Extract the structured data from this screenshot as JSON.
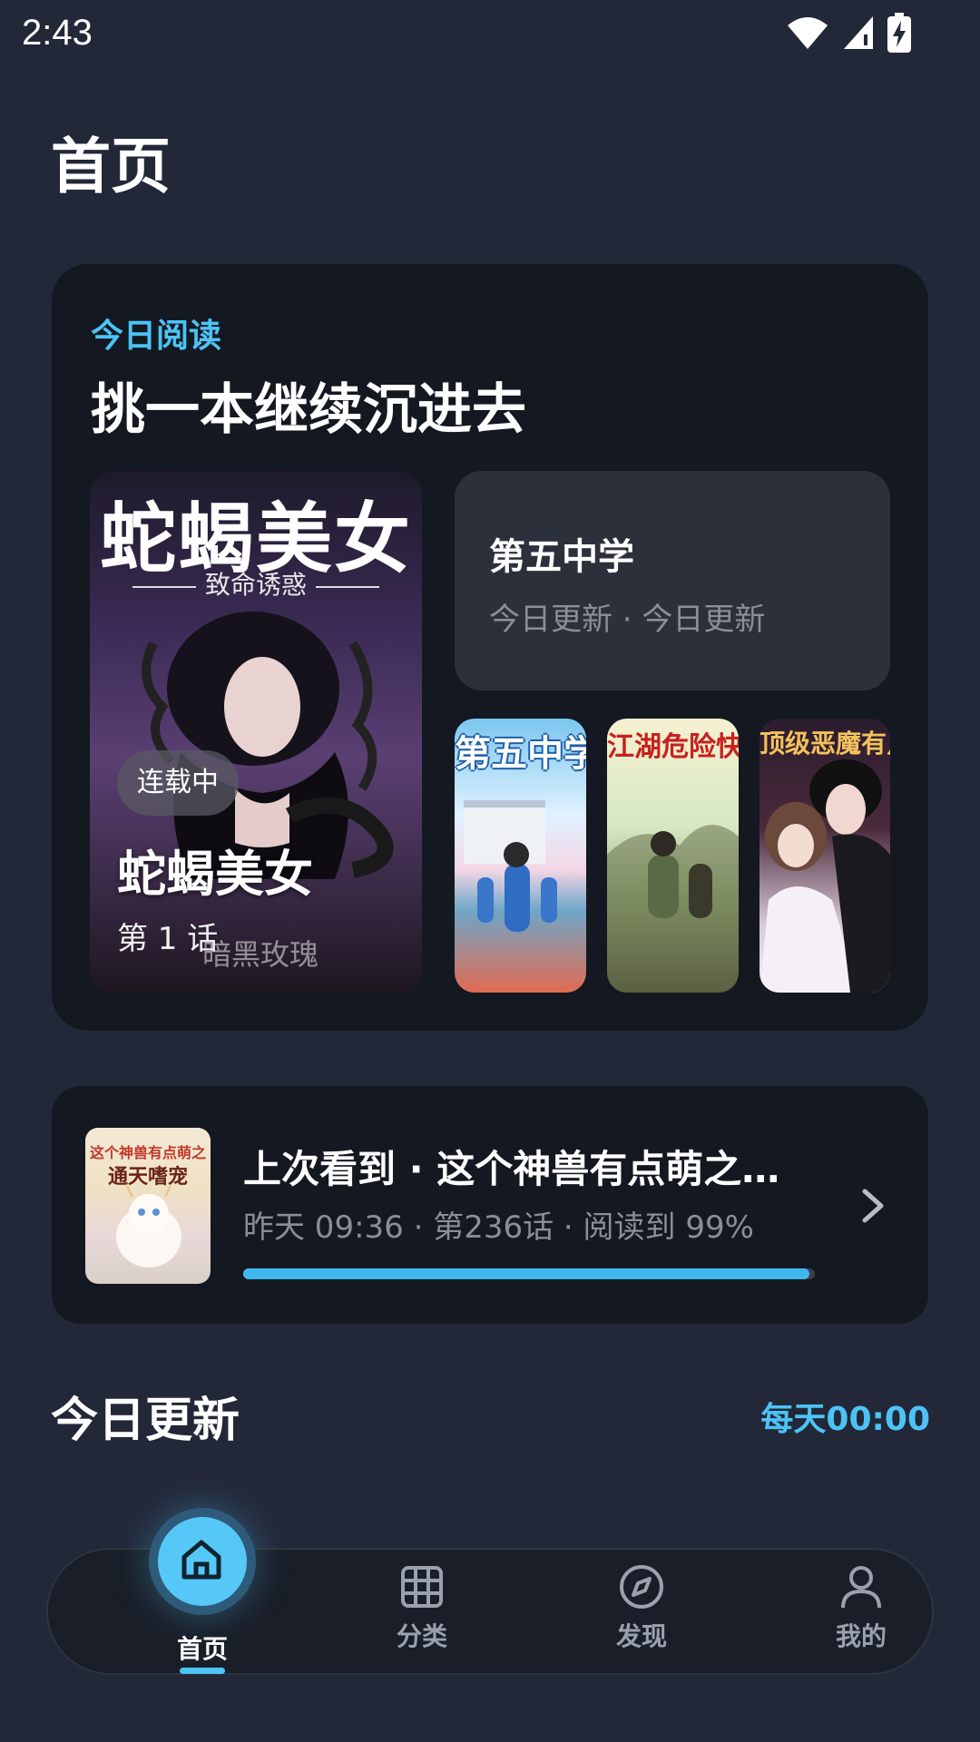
{
  "status_bar": {
    "time": "2:43"
  },
  "page": {
    "title": "首页"
  },
  "hero": {
    "eyebrow": "今日阅读",
    "headline": "挑一本继续沉进去",
    "featured": {
      "cover_title": "蛇蝎美女",
      "cover_subtitle": "致命诱惑",
      "badge": "连载中",
      "title": "蛇蝎美女",
      "episode": "第 1 话",
      "cover_author": "暗黑玫瑰"
    },
    "info": {
      "title": "第五中学",
      "subtitle": "今日更新 · 今日更新"
    },
    "thumbnails": [
      {
        "title": "第五中学"
      },
      {
        "title": "江湖危险快点跑"
      },
      {
        "title": "顶级恶魔有点甜"
      }
    ]
  },
  "continue_reading": {
    "cover_line1": "这个神兽有点萌之",
    "cover_line2": "通天嗜宠",
    "title": "上次看到 · 这个神兽有点萌之…",
    "meta": "昨天 09:36 · 第236话 · 阅读到 99%",
    "progress": 0.99
  },
  "today_updates": {
    "title": "今日更新",
    "time_label": "每天00:00"
  },
  "bottom_nav": {
    "items": [
      {
        "label": "首页",
        "icon": "home-icon",
        "active": true
      },
      {
        "label": "分类",
        "icon": "grid-icon",
        "active": false
      },
      {
        "label": "发现",
        "icon": "compass-icon",
        "active": false
      },
      {
        "label": "我的",
        "icon": "user-icon",
        "active": false
      }
    ]
  },
  "colors": {
    "accent": "#4cc3f5",
    "background": "#232838",
    "card": "#141821"
  }
}
